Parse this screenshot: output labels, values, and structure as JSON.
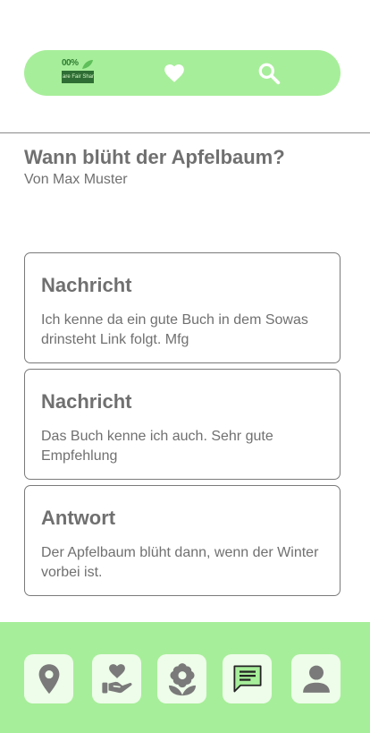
{
  "header": {
    "logo": {
      "percent_text": "00%",
      "banner_text": "are Fair Share"
    },
    "icons": [
      "heart-icon",
      "search-icon"
    ]
  },
  "question": {
    "title": "Wann blüht der Apfelbaum?",
    "author": "Von Max Muster"
  },
  "messages": [
    {
      "title": "Nachricht",
      "text": "Ich kenne da ein gute Buch in dem Sowas drinsteht Link folgt. Mfg"
    },
    {
      "title": "Nachricht",
      "text": "Das Buch kenne ich auch. Sehr gute Empfehlung"
    },
    {
      "title": "Antwort",
      "text": "Der Apfelbaum blüht dann, wenn der Winter vorbei ist."
    }
  ],
  "bottom_nav": {
    "items": [
      "location-pin-icon",
      "heart-hand-icon",
      "flower-icon",
      "chat-icon",
      "user-icon"
    ],
    "active": "chat-icon"
  },
  "colors": {
    "accent_green": "#a7ee9a",
    "button_bg": "#eefcea",
    "icon_gray": "#7a7a7a",
    "active_icon": "#a7ee9a",
    "text_gray": "#707070"
  }
}
